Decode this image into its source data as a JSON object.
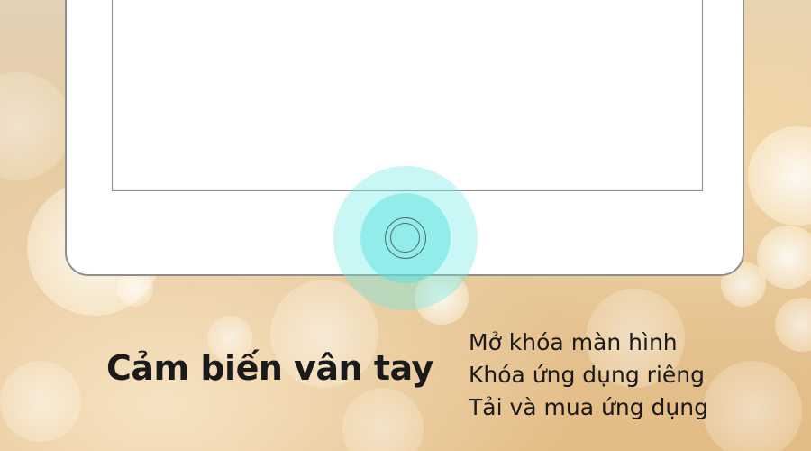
{
  "title": "Cảm biến vân tay",
  "features": [
    "Mở khóa màn hình",
    "Khóa ứng dụng riêng",
    "Tải và mua ứng dụng"
  ],
  "colors": {
    "glow": "#6eebe6",
    "outline": "#8e8e8e",
    "text": "#1a1a1a"
  }
}
